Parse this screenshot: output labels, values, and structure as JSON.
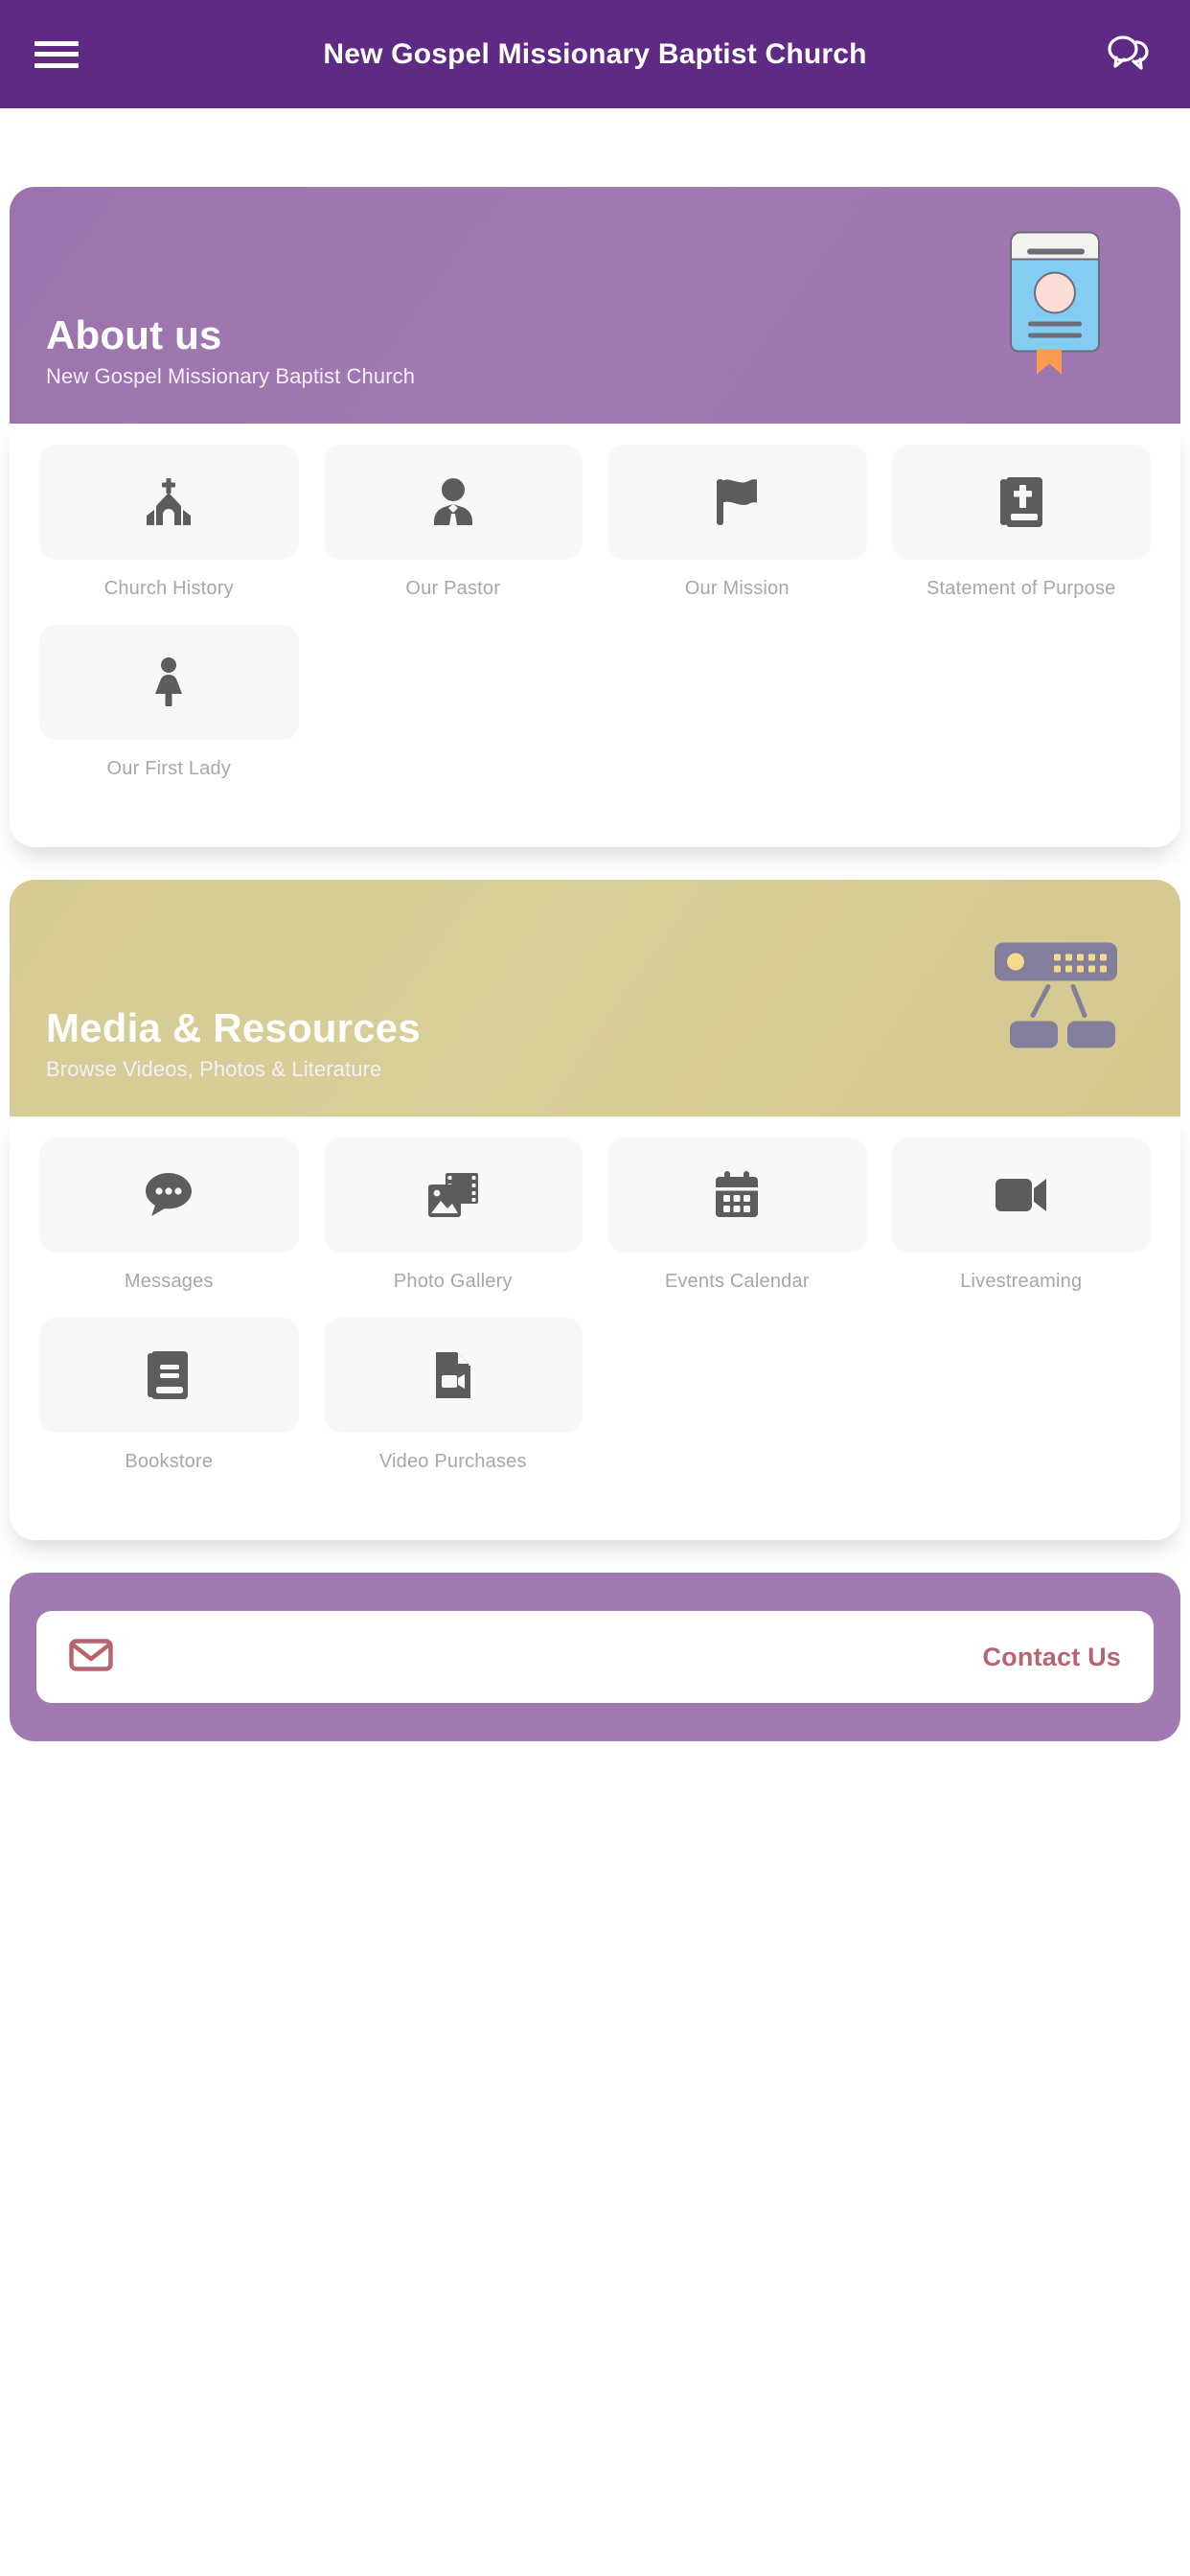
{
  "appbar": {
    "title": "New Gospel Missionary Baptist Church",
    "menu_icon": "hamburger-menu-icon",
    "chat_icon": "chat-bubbles-icon",
    "background_color": "#5e2a84"
  },
  "sections": [
    {
      "id": "about",
      "banner": {
        "title": "About us",
        "subtitle": "New Gospel Missionary Baptist Church",
        "art_icon": "blue-book-illustration",
        "gradient_from": "#9a72ad",
        "gradient_to": "#9e76b0"
      },
      "tiles": [
        {
          "label": "Church History",
          "icon": "church-icon"
        },
        {
          "label": "Our Pastor",
          "icon": "person-in-tie-icon"
        },
        {
          "label": "Our Mission",
          "icon": "flag-icon"
        },
        {
          "label": "Statement of Purpose",
          "icon": "bible-book-cross-icon"
        },
        {
          "label": "Our First Lady",
          "icon": "woman-figure-icon"
        }
      ]
    },
    {
      "id": "media",
      "banner": {
        "title": "Media & Resources",
        "subtitle": "Browse Videos, Photos & Literature",
        "art_icon": "network-router-illustration",
        "gradient_from": "#d5cb93",
        "gradient_to": "#d4c98f"
      },
      "tiles": [
        {
          "label": "Messages",
          "icon": "speech-bubble-dots-icon"
        },
        {
          "label": "Photo Gallery",
          "icon": "photo-film-icon"
        },
        {
          "label": "Events Calendar",
          "icon": "calendar-icon"
        },
        {
          "label": "Livestreaming",
          "icon": "video-camera-icon"
        },
        {
          "label": "Bookstore",
          "icon": "book-icon"
        },
        {
          "label": "Video Purchases",
          "icon": "file-video-icon"
        }
      ]
    }
  ],
  "contact": {
    "label": "Contact Us",
    "icon": "envelope-icon",
    "accent_color": "#b5656e",
    "panel_color": "#a27ab2"
  }
}
